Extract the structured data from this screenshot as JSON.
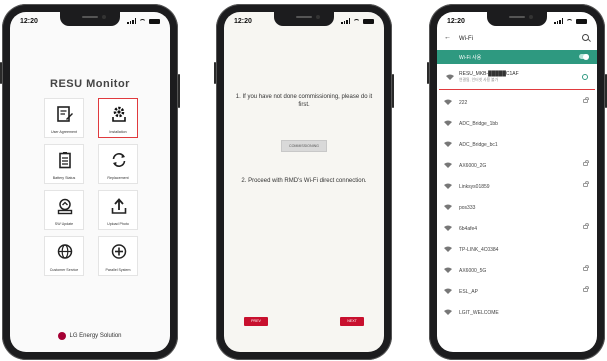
{
  "status_bar": {
    "time": "12:20"
  },
  "screen1": {
    "app_name": "RESU Monitor",
    "tiles": [
      {
        "label": "User Agreement",
        "icon": "document-pen-icon"
      },
      {
        "label": "Installation",
        "icon": "gear-install-icon"
      },
      {
        "label": "Battery Status",
        "icon": "battery-list-icon"
      },
      {
        "label": "Replacement",
        "icon": "refresh-icon"
      },
      {
        "label": "SW Update",
        "icon": "update-icon"
      },
      {
        "label": "Upload Photo",
        "icon": "upload-icon"
      },
      {
        "label": "Customer Service",
        "icon": "globe-icon"
      },
      {
        "label": "Parallel System",
        "icon": "plus-circle-icon"
      }
    ],
    "footer": "LG Energy Solution",
    "highlight_color": "#e03a3e"
  },
  "screen2": {
    "message1": "1. If you have not done commissioning, please do it first.",
    "commissioning_button": "COMMISSIONING",
    "message2": "2. Proceed with RMD's Wi-Fi direct connection.",
    "prev_button": "PREV",
    "next_button": "NEXT",
    "button_color": "#c8102e"
  },
  "screen3": {
    "title": "Wi-Fi",
    "toggle_label": "Wi-Fi 사용",
    "toggle_color": "#2e9980",
    "connected": {
      "name": "RESU_MKB-█████C1AF",
      "status": "연결됨, 인터넷 사용 불가"
    },
    "networks": [
      {
        "name": "222",
        "locked": true
      },
      {
        "name": "ADC_Bridge_1bb",
        "locked": false
      },
      {
        "name": "ADC_Bridge_bc1",
        "locked": false
      },
      {
        "name": "AX6000_2G",
        "locked": true
      },
      {
        "name": "Linksys01859",
        "locked": true
      },
      {
        "name": "pos333",
        "locked": false
      },
      {
        "name": "6b4afe4",
        "locked": true
      },
      {
        "name": "TP-LINK_4C0384",
        "locked": false
      },
      {
        "name": "AX6000_5G",
        "locked": true
      },
      {
        "name": "ESL_AP",
        "locked": true
      },
      {
        "name": "LGIT_WELCOME",
        "locked": false
      }
    ]
  }
}
